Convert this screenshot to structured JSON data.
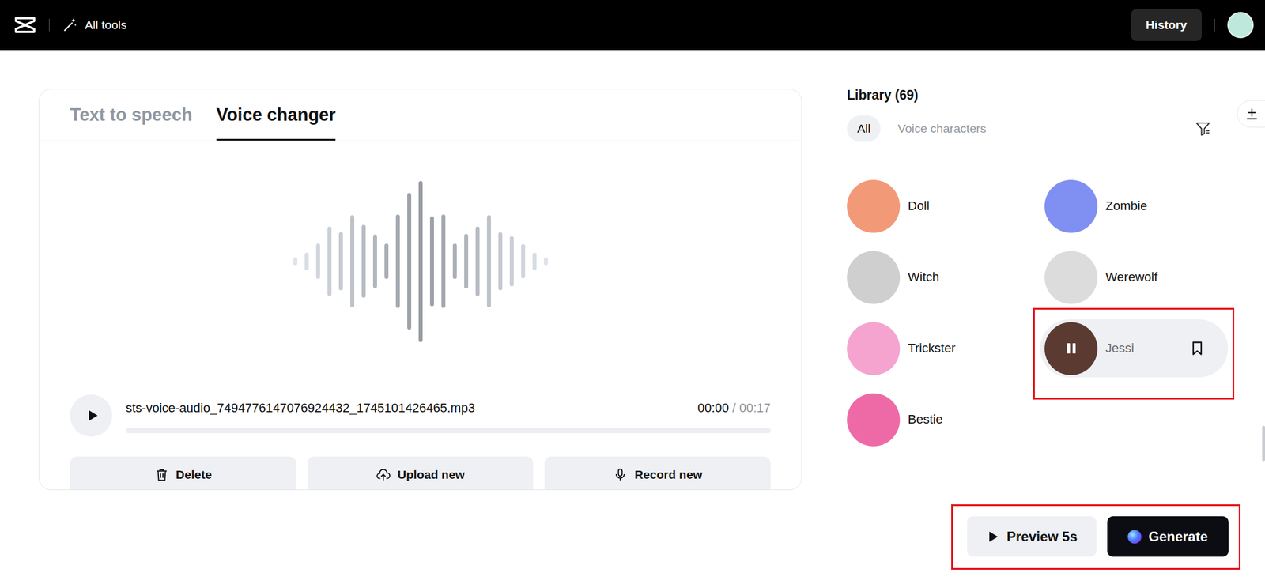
{
  "topbar": {
    "menu": "All tools",
    "history_button": "History"
  },
  "tabs": [
    {
      "label": "Text to speech",
      "selected": false
    },
    {
      "label": "Voice changer",
      "selected": true
    }
  ],
  "waveform": [
    0.05,
    0.11,
    0.22,
    0.43,
    0.36,
    0.57,
    0.45,
    0.33,
    0.22,
    0.58,
    0.85,
    1,
    0.56,
    0.58,
    0.22,
    0.34,
    0.43,
    0.57,
    0.36,
    0.31,
    0.21,
    0.11,
    0.05
  ],
  "audio": {
    "filename": "sts-voice-audio_7494776147076924432_1745101426465.mp3",
    "current": "00:00",
    "separator": "/",
    "duration": "00:17",
    "level": 0,
    "playing": false
  },
  "audio_buttons": [
    "Delete",
    "Upload new",
    "Record new"
  ],
  "library": {
    "title": "Library (69)",
    "filters": [
      {
        "label": "All",
        "selected": true
      },
      {
        "label": "Voice characters",
        "selected": false
      }
    ]
  },
  "voices": [
    {
      "name": "Doll",
      "color": "#f29a78",
      "selected": false,
      "playing": false,
      "highlighted": false
    },
    {
      "name": "Zombie",
      "color": "#7f8ff2",
      "selected": false,
      "playing": false,
      "highlighted": false
    },
    {
      "name": "Witch",
      "color": "#cfcfcf",
      "selected": false,
      "playing": false,
      "highlighted": false
    },
    {
      "name": "Werewolf",
      "color": "#dcdcdc",
      "selected": false,
      "playing": false,
      "highlighted": false
    },
    {
      "name": "Trickster",
      "color": "#f5a3cf",
      "selected": false,
      "playing": false,
      "highlighted": false
    },
    {
      "name": "Jessi",
      "color": "#5b3b31",
      "selected": true,
      "playing": true,
      "highlighted": true
    },
    {
      "name": "Bestie",
      "color": "#ee6aa7",
      "selected": false,
      "playing": false,
      "highlighted": false
    }
  ],
  "actions": {
    "preview": "Preview 5s",
    "generate": "Generate",
    "highlighted": true
  }
}
